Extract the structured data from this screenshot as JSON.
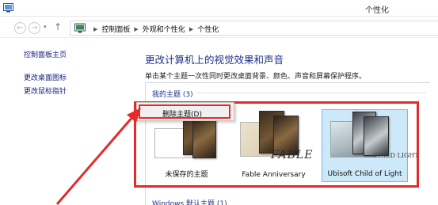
{
  "window": {
    "title": "个性化"
  },
  "nav": {
    "back_glyph": "←",
    "forward_glyph": "→",
    "dropdown_glyph": "▾",
    "up_glyph": "↑"
  },
  "address": {
    "crumbs": [
      "控制面板",
      "外观和个性化",
      "个性化"
    ],
    "separator": "▶"
  },
  "sidebar": {
    "items": [
      {
        "label": "控制面板主页"
      },
      {
        "label": "更改桌面图标"
      },
      {
        "label": "更改鼠标指针"
      }
    ]
  },
  "main": {
    "heading": "更改计算机上的视觉效果和声音",
    "description": "单击某个主题一次性同时更改桌面背景、颜色、声音和屏幕保护程序。",
    "my_themes_header": "我的主题 (3)",
    "windows_themes_header": "Windows 默认主题 (1)"
  },
  "context_menu": {
    "delete_label": "删除主题(D)"
  },
  "themes": [
    {
      "label": "未保存的主题",
      "selected": false
    },
    {
      "label": "Fable Anniversary",
      "logo_text": "FABLE",
      "selected": false
    },
    {
      "label": "Ubisoft Child of Light",
      "logo_text": "CHILD LIGHT",
      "selected": true
    }
  ],
  "colors": {
    "accent": "#1e3287",
    "highlight_red": "#e52a2a",
    "selection_blue": "#cde8f8",
    "link": "#1a1a80"
  },
  "icons": [
    "control-panel-icon",
    "back-arrow-icon",
    "forward-arrow-icon",
    "up-arrow-icon",
    "breadcrumb-separator-icon",
    "annotation-arrow"
  ]
}
